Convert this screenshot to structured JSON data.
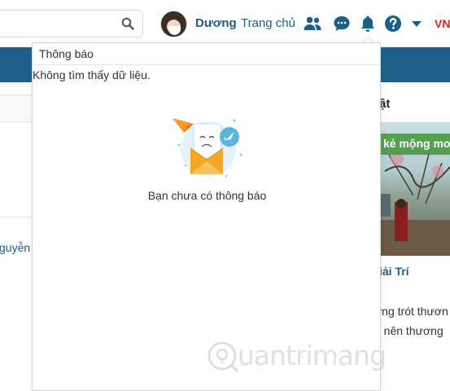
{
  "header": {
    "search": {
      "placeholder": "",
      "value": ""
    },
    "user_name": "Dương",
    "home_link": "Trang chủ",
    "language": "VN",
    "icons": [
      "search-icon",
      "friends-icon",
      "messages-icon",
      "bell-icon",
      "help-icon",
      "caret-down-icon"
    ],
    "colors": {
      "link": "#1d5e86",
      "band": "#1d6188",
      "lang": "#d9241c"
    }
  },
  "background": {
    "left_text": "guyễn",
    "right_title": "ật",
    "thumb_caption": "kẻ mộng mơ",
    "right_category": "iải Trí",
    "right_line1": "ơng trót thươn",
    "right_line2": "a nên thương"
  },
  "notifications": {
    "title": "Thông báo",
    "message": "Không tìm thấy dữ liệu.",
    "empty_text": "Bạn chưa có thông báo"
  },
  "watermark": {
    "text": "uantrimang"
  }
}
